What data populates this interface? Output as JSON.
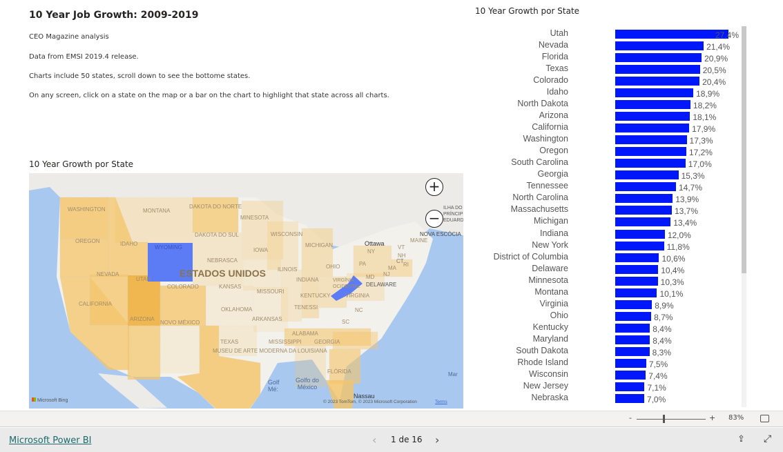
{
  "report": {
    "title": "10 Year Job Growth: 2009-2019",
    "notes": [
      "CEO Magazine analysis",
      "Data from EMSI 2019.4 release.",
      "Charts include 50 states, scroll down to see the bottome states.",
      "On any screen, click on a state on the map or a bar on the chart to highlight that state across all charts."
    ]
  },
  "map": {
    "title": "10 Year Growth por State",
    "country_label": "ESTADOS UNIDOS",
    "highlight_color": "#5b7cf5",
    "fill_color": "#f5c56a",
    "labels": [
      "WASHINGTON",
      "MONTANA",
      "DAKOTA DO NORTE",
      "MINESOTA",
      "OREGON",
      "IDAHO",
      "WYOMING",
      "DAKOTA DO SUL",
      "WISCONSIN",
      "MICHIGAN",
      "IOWA",
      "NEBRASCA",
      "NEVADA",
      "UTAH",
      "COLORADO",
      "KANSAS",
      "ILINOIS",
      "INDIANA",
      "OHIO",
      "PA",
      "NY",
      "MISSOURI",
      "KENTUCKY",
      "VIRGINIA",
      "VIRGÍNIA OCIDENTAL",
      "MD",
      "DELAWARE",
      "NJ",
      "CALIFORNIA",
      "ARIZONA",
      "NOVO MÉXICO",
      "OKLAHOMA",
      "ARKANSAS",
      "TENESSI",
      "NC",
      "SC",
      "ALABAMA",
      "MISSISSIPPI",
      "GEORGIA",
      "TEXAS",
      "MUSEU DE ARTE MODERNA DA LOUISIANA",
      "FLÓRIDA",
      "Ottawa",
      "VT",
      "NH",
      "MAINE",
      "MA",
      "CT",
      "RI",
      "ILHA DO PRÍNCIPE EDUARDO",
      "NOVA ESCÓCIA",
      "Golfo do México",
      "Golf Mé:",
      "Nassau",
      "Mar"
    ],
    "attribution": "© 2023 TomTom, © 2023 Microsoft Corporation",
    "terms": "Terms",
    "bing": "Microsoft Bing",
    "zoom_in": "+",
    "zoom_out": "−"
  },
  "chart_data": {
    "type": "bar",
    "orientation": "horizontal",
    "title": "10 Year Growth por State",
    "bar_color": "#0018f9",
    "categories": [
      "Utah",
      "Nevada",
      "Florida",
      "Texas",
      "Colorado",
      "Idaho",
      "North Dakota",
      "Arizona",
      "California",
      "Washington",
      "Oregon",
      "South Carolina",
      "Georgia",
      "Tennessee",
      "North Carolina",
      "Massachusetts",
      "Michigan",
      "Indiana",
      "New York",
      "District of Columbia",
      "Delaware",
      "Minnesota",
      "Montana",
      "Virginia",
      "Ohio",
      "Kentucky",
      "Maryland",
      "South Dakota",
      "Rhode Island",
      "Wisconsin",
      "New Jersey",
      "Nebraska"
    ],
    "values": [
      27.4,
      21.4,
      20.9,
      20.5,
      20.4,
      18.9,
      18.2,
      18.1,
      17.9,
      17.3,
      17.2,
      17.0,
      15.3,
      14.7,
      13.9,
      13.7,
      13.4,
      12.0,
      11.8,
      10.6,
      10.4,
      10.3,
      10.1,
      8.9,
      8.7,
      8.4,
      8.4,
      8.3,
      7.5,
      7.4,
      7.1,
      7.0
    ],
    "labels": [
      "27,4%",
      "21,4%",
      "20,9%",
      "20,5%",
      "20,4%",
      "18,9%",
      "18,2%",
      "18,1%",
      "17,9%",
      "17,3%",
      "17,2%",
      "17,0%",
      "15,3%",
      "14,7%",
      "13,9%",
      "13,7%",
      "13,4%",
      "12,0%",
      "11,8%",
      "10,6%",
      "10,4%",
      "10,3%",
      "10,1%",
      "8,9%",
      "8,7%",
      "8,4%",
      "8,4%",
      "8,3%",
      "7,5%",
      "7,4%",
      "7,1%",
      "7,0%"
    ]
  },
  "zoom": {
    "minus": "-",
    "plus": "+",
    "level": "83%",
    "level_value": 83
  },
  "footer": {
    "brand": "Microsoft Power BI",
    "page": "1 de 16",
    "prev": "‹",
    "next": "›"
  }
}
